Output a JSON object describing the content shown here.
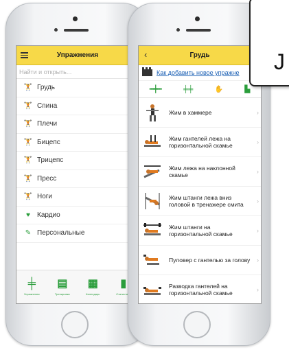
{
  "left_phone": {
    "title": "Упражнения",
    "search_placeholder": "Найти и открыть...",
    "categories": [
      {
        "label": "Грудь",
        "icon": "chest-muscle-icon"
      },
      {
        "label": "Спина",
        "icon": "back-muscle-icon"
      },
      {
        "label": "Плечи",
        "icon": "shoulders-muscle-icon"
      },
      {
        "label": "Бицепс",
        "icon": "biceps-muscle-icon"
      },
      {
        "label": "Трицепс",
        "icon": "triceps-muscle-icon"
      },
      {
        "label": "Пресс",
        "icon": "abs-muscle-icon"
      },
      {
        "label": "Ноги",
        "icon": "legs-muscle-icon"
      },
      {
        "label": "Кардио",
        "icon": "heart-icon"
      },
      {
        "label": "Персональные",
        "icon": "pencil-icon"
      }
    ],
    "tabs": [
      {
        "label": "Упражнения",
        "icon": "dumbbell-icon"
      },
      {
        "label": "Тренировки",
        "icon": "clipboard-icon"
      },
      {
        "label": "Календарь",
        "icon": "calendar-icon"
      },
      {
        "label": "Статистика",
        "icon": "bar-chart-icon"
      }
    ]
  },
  "right_phone": {
    "title": "Грудь",
    "add_link": "Как добавить новое упражне",
    "filters": [
      {
        "icon": "barbell-icon"
      },
      {
        "icon": "dumbbell-icon"
      },
      {
        "icon": "hand-icon"
      },
      {
        "icon": "machine-icon"
      }
    ],
    "exercises": [
      {
        "label": "Жим в хаммере"
      },
      {
        "label": "Жим гантелей лежа на горизонтальной скамье"
      },
      {
        "label": "Жим лежа на наклонной скамье"
      },
      {
        "label": "Жим штанги лежа вниз головой в тренажере смита"
      },
      {
        "label": "Жим штанги на горизонтальной скамье"
      },
      {
        "label": "Пуловер с гантелью за голову"
      },
      {
        "label": "Разводка гантелей на горизонтальной скамье"
      }
    ]
  },
  "callout": {
    "glyph": "J"
  },
  "colors": {
    "navbar": "#f7d948",
    "accent_green": "#2a9d3b",
    "link_blue": "#1a5fb4",
    "heart": "#2a9d3b"
  }
}
